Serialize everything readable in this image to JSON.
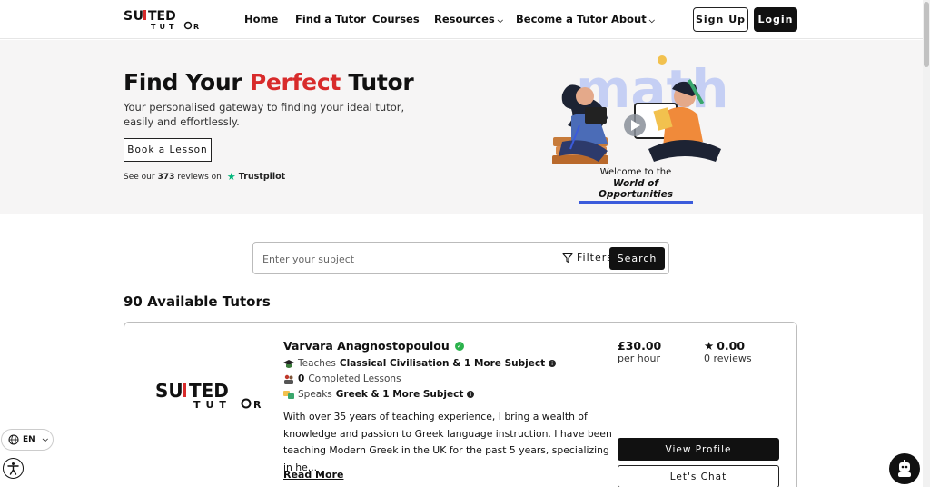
{
  "header": {
    "logo_text": "SUITED TUTOR",
    "logo_main": "SUITED",
    "logo_sub": "TUTOR",
    "nav": [
      {
        "label": "Home"
      },
      {
        "label": "Find a Tutor"
      },
      {
        "label": "Courses"
      },
      {
        "label": "Resources",
        "dropdown": true
      },
      {
        "label": "Become a Tutor"
      },
      {
        "label": "About",
        "dropdown": true
      }
    ],
    "sign_up": "Sign Up",
    "login": "Login"
  },
  "hero": {
    "title_part1": "Find Your",
    "title_accent": "Perfect",
    "title_part2": "Tutor",
    "subtitle": "Your personalised gateway to finding your ideal tutor, easily and effortlessly.",
    "book_button": "Book a Lesson",
    "trust_prefix": "See our",
    "trust_count": "373",
    "trust_suffix": "reviews on",
    "trust_brand": "Trustpilot",
    "welcome_line1": "Welcome to the",
    "welcome_line2": "World of Opportunities"
  },
  "search": {
    "placeholder": "Enter your subject",
    "filters_label": "Filters",
    "search_button": "Search"
  },
  "results": {
    "count_label": "90 Available Tutors"
  },
  "tutor": {
    "name": "Varvara Anagnostopoulou",
    "teaches_label": "Teaches",
    "teaches_value": "Classical Civilisation & 1 More Subject",
    "lessons_count": "0",
    "lessons_label": "Completed Lessons",
    "speaks_label": "Speaks",
    "speaks_value": "Greek & 1 More Subject",
    "bio": "With over 35 years of teaching experience, I bring a wealth of knowledge and passion to Greek language instruction. I have been teaching Modern Greek in the UK for the past 5 years, specializing in he...",
    "read_more": "Read More",
    "price": "£30.00",
    "price_unit": "per hour",
    "rating": "0.00",
    "reviews": "0 reviews",
    "view_profile": "View Profile",
    "chat": "Let's Chat"
  },
  "widgets": {
    "language": "EN"
  },
  "colors": {
    "accent": "#d82b2b",
    "primary": "#111111",
    "trustpilot": "#00b67a",
    "verified": "#2bb24c"
  }
}
